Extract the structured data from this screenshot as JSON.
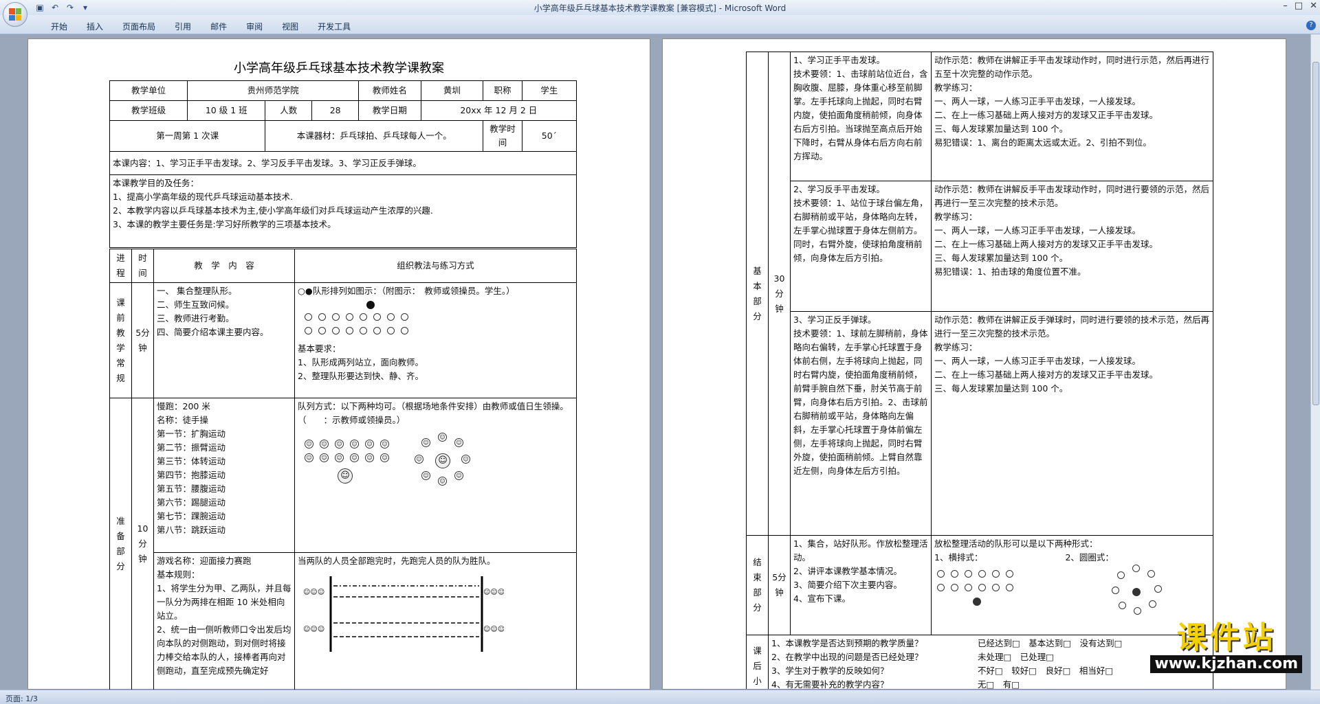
{
  "window": {
    "title": "小学高年级乒乓球基本技术教学课教案 [兼容模式] - Microsoft Word"
  },
  "ribbon": {
    "tabs": [
      "开始",
      "插入",
      "页面布局",
      "引用",
      "邮件",
      "审阅",
      "视图",
      "开发工具"
    ]
  },
  "status": {
    "page": "页面: 1/3"
  },
  "doc": {
    "title": "小学高年级乒乓球基本技术教学课教案",
    "header": {
      "unit_label": "教学单位",
      "unit": "贵州师范学院",
      "teacher_label": "教师姓名",
      "teacher": "黄圳",
      "title_label": "职称",
      "title_val": "学生",
      "class_label": "教学班级",
      "class": "10 级 1 班",
      "count_label": "人数",
      "count": "28",
      "date_label": "教学日期",
      "date": "20xx 年 12 月 2 日",
      "week": "第一周第 1 次课",
      "equipment": "本课器材：乒乓球拍、乒乓球每人一个。",
      "time_label": "教学时间",
      "time": "50ˊ"
    },
    "content": "本课内容：1、学习正手平击发球。2、学习反手平击发球。3、学习正反手弹球。",
    "goals": [
      "本课教学目的及任务：",
      "1、提高小学高年级的现代乒乓球运动基本技术.",
      "2、本教学内容以乒乓球基本技术为主,使小学高年级们对乒乓球运动产生浓厚的兴趣.",
      "3、本课的教学主要任务是:学习好所教学的三项基本技术。"
    ],
    "cols": {
      "stage": "进程",
      "time": "时间",
      "content": "教　学　内　容",
      "method": "组织教法与练习方式"
    },
    "row1": {
      "stage": "课前教学常规",
      "time": "5分钟",
      "content": [
        "一、 集合整理队形。",
        "二、师生互致问候。",
        "三、教师进行考勤。",
        "四、简要介绍本课主要内容。"
      ],
      "method_top": "○●队形排列如图示：（附图示：　教师或领操员。学生。）",
      "method_req": [
        "基本要求：",
        "1、队形成两列站立，面向教师。",
        "2、整理队形要达到快、静、齐。"
      ]
    },
    "row2": {
      "stage": "准备部分",
      "time": "10分钟",
      "content": [
        "慢跑：200 米",
        "名称：徒手操",
        "第一节：扩胸运动",
        "第二节：振臂运动",
        "第三节：体转运动",
        "第四节：抱膝运动",
        "第五节：腰腹运动",
        "第六节：踢腿运动",
        "第七节：踝腕运动",
        "第八节：跳跃运动"
      ],
      "method": "队列方式：以下两种均可。（根据场地条件安排）由教师或值日生领操。（　　：示教师或领操员。）"
    },
    "row3": {
      "content": [
        "游戏名称：迎面接力赛跑",
        "基本规则：",
        "1、将学生分为甲、乙两队，并且每一队分为两排在相距 10 米处相向站立。",
        "2、统一由一侧听教师口令出发后均向本队的对侧跑动，到对侧时将接力棒交给本队的人，接棒者再向对侧跑动，直至完成预先确定好"
      ],
      "method": "当两队的人员全部跑完时，先跑完人员的队为胜队。"
    },
    "p2": {
      "stage": "基本部分",
      "time": "30分钟",
      "r1_content": [
        "1、学习正手平击发球。",
        "技术要领：1、击球前站位近台，含胸收腹、屈膝，身体重心移至前脚掌。左手托球向上抛起，同时右臂内旋，使拍面角度稍前倾，向身体右后方引拍。当球抛至高点后开始下降时，右臂从身体右后方向右前方挥动。"
      ],
      "r1_method": [
        "动作示范：教师在讲解正手平击发球动作时，同时进行示范，然后再进行五至十次完整的动作示范。",
        "教学练习：",
        "一、两人一球，一人练习正手平击发球，一人接发球。",
        "二、在上一练习基础上两人接对方的发球又正手平击发球。",
        "三、每人发球累加量达到 100 个。",
        "易犯错误：1、离台的距离太远或太近。2、引拍不到位。"
      ],
      "r2_content": [
        "2、学习反手平击发球。",
        "技术要领：1、站位于球台偏左角，右脚稍前或平站，身体略向左转，左手掌心抛球置于身体左侧前方。同时，右臂外旋，使球拍角度稍前倾，向身体左后方引拍。"
      ],
      "r2_method": [
        "动作示范：教师在讲解反手平击发球动作时，同时进行要领的示范，然后再进行一至三次完整的技术示范。",
        "教学练习：",
        "一、两人一球，一人练习正手平击发球，一人接发球。",
        "二、在上一练习基础上两人接对方的发球又正手平击发球。",
        "三、每人发球累加量达到 100 个。",
        "易犯错误：1、拍击球的角度位置不准。"
      ],
      "r3_content": [
        "3、学习正反手弹球。",
        "技术要领：1、球前左脚稍前，身体略向右偏转，左手掌心托球置于身体前右侧，左手将球向上抛起，同时右臂内旋，使拍面角度稍前倾，前臂手腕自然下垂，肘关节高于前臂，向身体右后方引拍。2、击球前右脚稍前或平站，身体略向左偏斜，左手掌心托球置于身体前偏左侧，左手将球向上抛起，同时右臂外旋，使拍面稍前倾。上臂自然靠近左侧，向身体左后方引拍。"
      ],
      "r3_method": [
        "动作示范：教师在讲解正反手弹球时，同时进行要领的技术示范，然后再进行一至三次完整的技术示范。",
        "教学练习：",
        "一、两人一球，一人练习正手平击发球，一人接发球。",
        "二、在上一练习基础上两人接对方的发球又正手平击发球。",
        "三、每人发球累加量达到 100 个。"
      ],
      "end_stage": "结束部分",
      "end_time": "5分钟",
      "end_content": [
        "1、集合，站好队形。作放松整理活动。",
        "2、讲评本课教学基本情况。",
        "3、简要介绍下次主要内容。",
        "4、宣布下课。"
      ],
      "end_method": "放松整理活动的队形可以是以下两种形式：",
      "end_m1": "1、横排式：",
      "end_m2": "2、圆圈式：",
      "after_stage": "课后小",
      "after": [
        "1、本课教学是否达到预期的教学质量？",
        "2、在教学中出现的问题是否已经处理？",
        "3、学生对于教学的反映如何？",
        "4、有无需要补充的教学内容？"
      ],
      "after_ans": [
        "已经达到□　基本达到□　没有达到□",
        "未处理□　已处理□",
        "不好□　较好□　良好□　相当好□",
        "无□　有□"
      ]
    }
  },
  "watermark": {
    "main": "课件站",
    "url": "www.kjzhan.com"
  }
}
